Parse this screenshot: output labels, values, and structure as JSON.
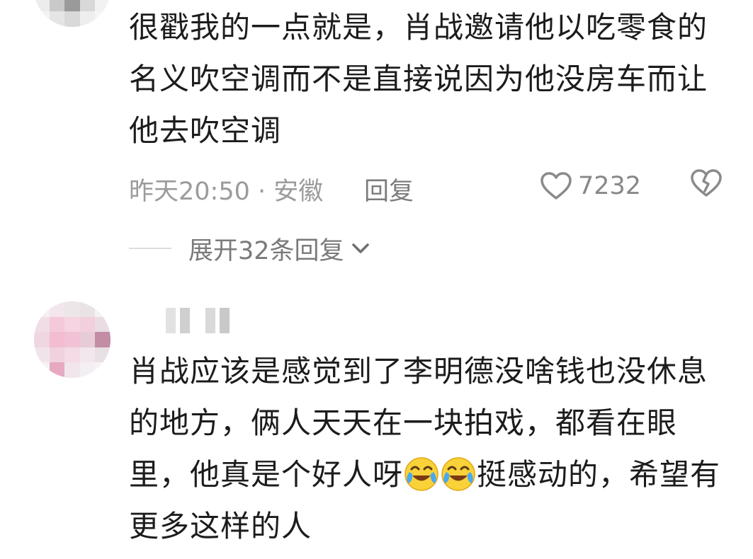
{
  "comments": [
    {
      "text": "很戳我的一点就是，肖战邀请他以吃零食的名义吹空调而不是直接说因为他没房车而让他去吹空调",
      "time_location": "昨天20:50 · 安徽",
      "reply_label": "回复",
      "like_count": "7232",
      "expand_label": "展开32条回复"
    },
    {
      "text_part1": "肖战应该是感觉到了李明德没啥钱也没休息的地方，俩人天天在一块拍戏，都看在眼里，他真是个好人呀",
      "text_part2": "挺感动的，希望有更多这样的人",
      "emojis": [
        "crying-laughing-emoji",
        "crying-laughing-emoji"
      ]
    }
  ],
  "icons": {
    "like": "heart-outline-icon",
    "dislike": "broken-heart-icon",
    "expand": "chevron-down-icon"
  }
}
